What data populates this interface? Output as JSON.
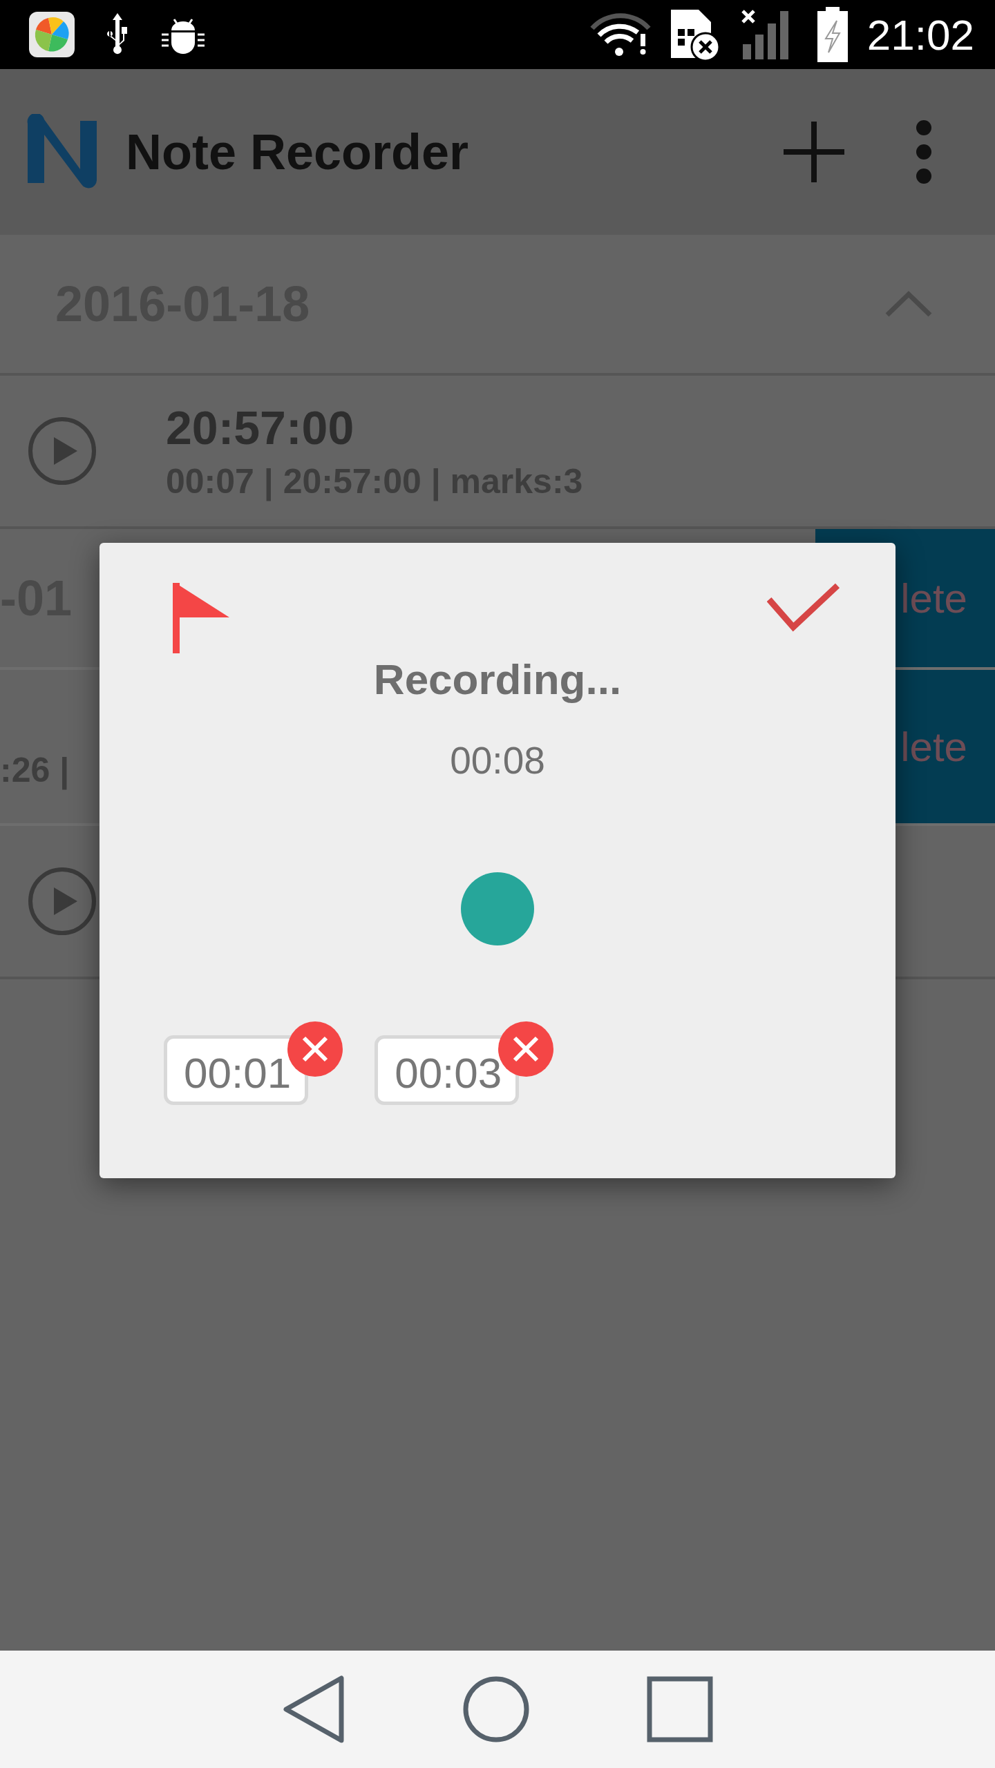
{
  "status_bar": {
    "time": "21:02"
  },
  "app_bar": {
    "title": "Note Recorder"
  },
  "list": {
    "date_header": "2016-01-18",
    "expanded": true,
    "rows": [
      {
        "kind": "recording",
        "title": "20:57:00",
        "subtitle": "00:07 | 20:57:00 | marks:3"
      },
      {
        "kind": "swiped_title",
        "text": "-01",
        "action": "lete"
      },
      {
        "kind": "swiped_subtitle",
        "text": ":26 |",
        "action": "lete"
      },
      {
        "kind": "recording"
      }
    ]
  },
  "dialog": {
    "title": "Recording...",
    "elapsed": "00:08",
    "recording": true,
    "marks": [
      {
        "time": "00:01"
      },
      {
        "time": "00:03"
      }
    ]
  }
}
